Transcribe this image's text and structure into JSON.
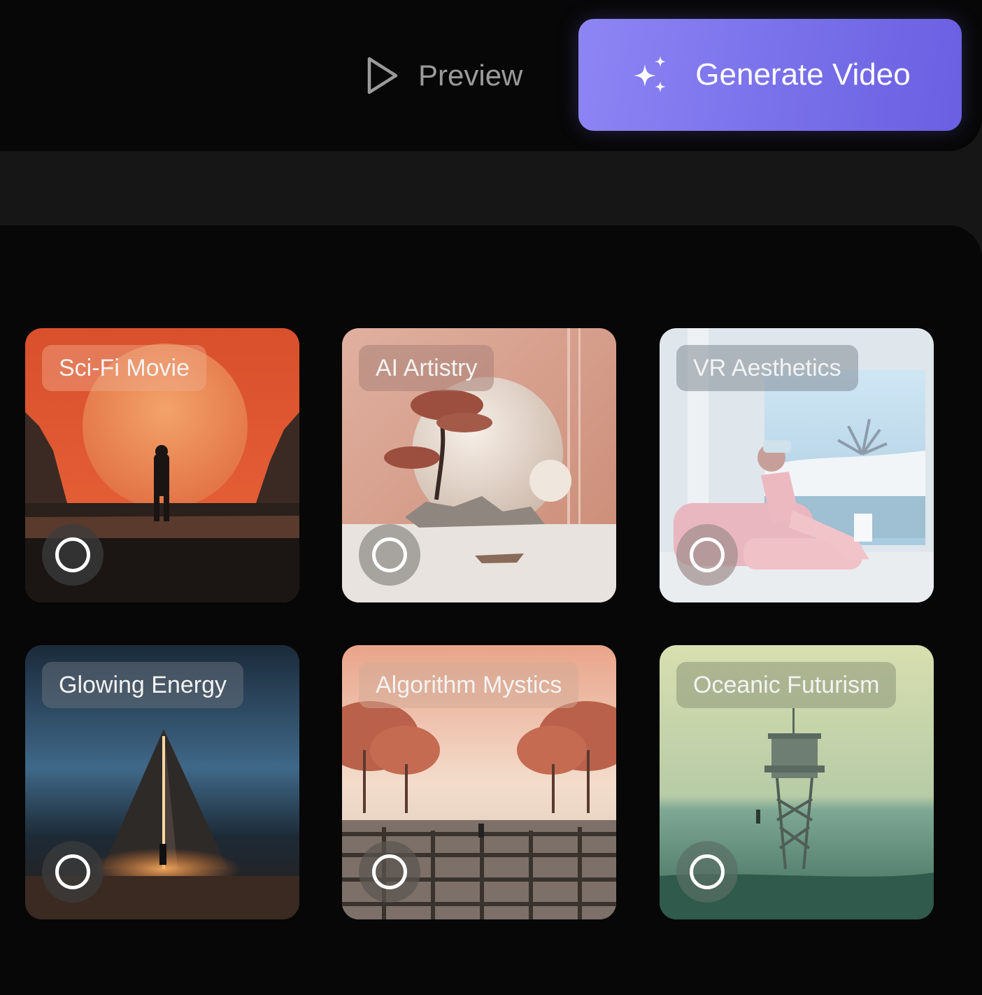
{
  "toolbar": {
    "preview_label": "Preview",
    "generate_label": "Generate Video"
  },
  "styles": [
    {
      "label": "Sci-Fi Movie"
    },
    {
      "label": "AI Artistry"
    },
    {
      "label": "VR Aesthetics"
    },
    {
      "label": "Glowing Energy"
    },
    {
      "label": "Algorithm Mystics"
    },
    {
      "label": "Oceanic Futurism"
    }
  ],
  "colors": {
    "accent_start": "#8e85f5",
    "accent_end": "#6a5fe2",
    "background": "#161616",
    "panel": "#070707"
  }
}
